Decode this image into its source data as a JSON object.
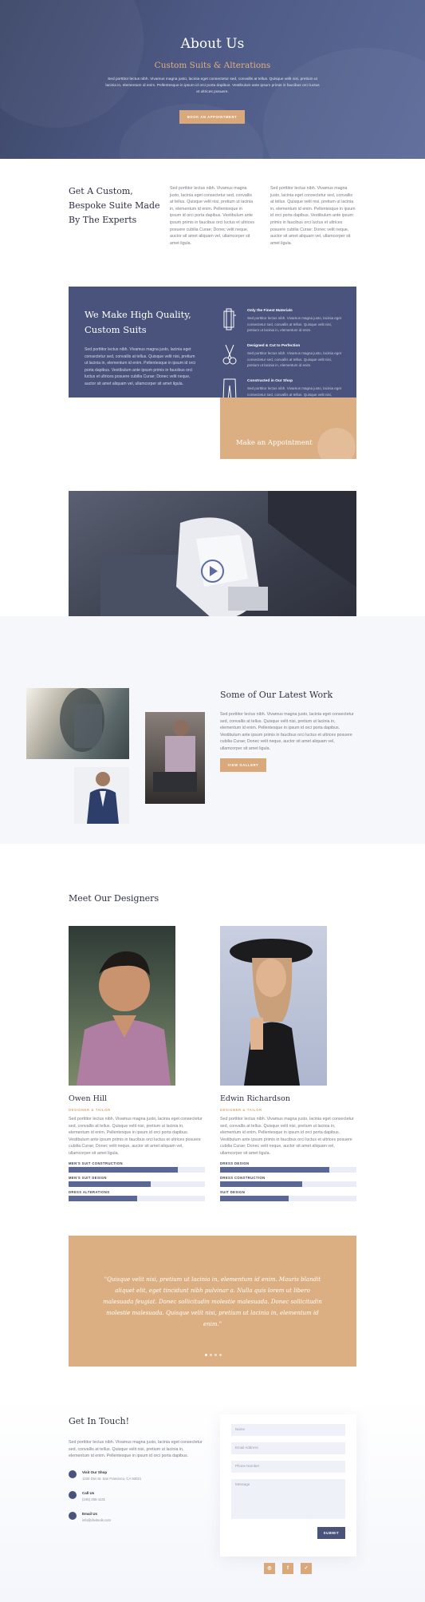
{
  "hero": {
    "title": "About Us",
    "subtitle": "Custom Suits & Alterations",
    "text": "Sed porttitor lectus nibh. Vivamus magna justo, lacinia eget consectetur sed, convallis at tellus. Quisque velit nisi, pretium ut lacinia in, elementum id enim. Pellentesque in ipsum id orci porta dapibus. Vestibulum ante ipsum primis in faucibus orci luctus et ultrices posuere.",
    "button": "BOOK AN APPOINTMENT"
  },
  "intro": {
    "title": "Get A Custom, Bespoke Suite Made By The Experts",
    "col1": "Sed porttitor lectus nibh. Vivamus magna justo, lacinia eget consectetur sed, convallis at tellus. Quisque velit nisi, pretium ut lacinia in, elementum id enim. Pellentesque in ipsum id orci porta dapibus. Vestibulum ante ipsum primis in faucibus orci luctus et ultrices posuere cubilia Curae; Donec velit neque, auctor sit amet aliquam vel, ullamcorper sit amet ligula.",
    "col2": "Sed porttitor lectus nibh. Vivamus magna justo, lacinia eget consectetur sed, convallis at tellus. Quisque velit nisi, pretium ut lacinia in, elementum id enim. Pellentesque in ipsum id orci porta dapibus. Vestibulum ante ipsum primis in faucibus orci luctus et ultrices posuere cubilia Curae; Donec velit neque, auctor sit amet aliquam vel, ullamcorper sit amet ligula."
  },
  "feature": {
    "title": "We Make High Quality, Custom Suits",
    "text": "Sed porttitor lectus nibh. Vivamus magna justo, lacinia eget consectetur sed, convallis at tellus. Quisque velit nisi, pretium ut lacinia in, elementum id enim. Pellentesque in ipsum id orci porta dapibus. Vestibulum ante ipsum primis in faucibus orci luctus et ultrices posuere cubilia Curae; Donec velit neque, auctor sit amet aliquam vel, ullamcorper sit amet ligula.",
    "items": [
      {
        "title": "Only the Finest Materials",
        "text": "Sed porttitor lectus nibh. Vivamus magna justo, lacinia eget consectetur sed, convallis at tellus. Quisque velit nisi, pretium ut lacinia in, elementum id enim."
      },
      {
        "title": "Designed & Cut to Perfection",
        "text": "Sed porttitor lectus nibh. Vivamus magna justo, lacinia eget consectetur sed, convallis at tellus. Quisque velit nisi, pretium ut lacinia in, elementum id enim."
      },
      {
        "title": "Constructed in Our Shop",
        "text": "Sed porttitor lectus nibh. Vivamus magna justo, lacinia eget consectetur sed, convallis at tellus. Quisque velit nisi, pretium ut lacinia in, elementum id enim."
      }
    ],
    "appointment": "Make an Appointment"
  },
  "gallery": {
    "title": "Some of Our Latest Work",
    "text": "Sed porttitor lectus nibh. Vivamus magna justo, lacinia eget consectetur sed, convallis at tellus. Quisque velit nisi, pretium ut lacinia in, elementum id enim. Pellentesque in ipsum id orci porta dapibus. Vestibulum ante ipsum primis in faucibus orci luctus et ultrices posuere cubilia Curae; Donec velit neque, auctor sit amet aliquam vel, ullamcorper sit amet ligula.",
    "button": "VIEW GALLERY"
  },
  "designers": {
    "title": "Meet Our Designers",
    "people": [
      {
        "name": "Owen Hill",
        "role": "DESIGNER & TAILOR",
        "text": "Sed porttitor lectus nibh. Vivamus magna justo, lacinia eget consectetur sed, convallis at tellus. Quisque velit nisi, pretium ut lacinia in, elementum id enim. Pellentesque in ipsum id orci porta dapibus. Vestibulum ante ipsum primis in faucibus orci luctus et ultrices posuere cubilia Curae; Donec velit neque, auctor sit amet aliquam vel, ullamcorper sit amet ligula.",
        "skills": [
          {
            "label": "MEN'S SUIT CONSTRUCTION",
            "level": 0.8
          },
          {
            "label": "MEN'S SUIT DESIGN",
            "level": 0.6
          },
          {
            "label": "DRESS ALTERATIONS",
            "level": 0.5
          }
        ]
      },
      {
        "name": "Edwin Richardson",
        "role": "DESIGNER & TAILOR",
        "text": "Sed porttitor lectus nibh. Vivamus magna justo, lacinia eget consectetur sed, convallis at tellus. Quisque velit nisi, pretium ut lacinia in, elementum id enim. Pellentesque in ipsum id orci porta dapibus. Vestibulum ante ipsum primis in faucibus orci luctus et ultrices posuere cubilia Curae; Donec velit neque, auctor sit amet aliquam vel, ullamcorper sit amet ligula.",
        "skills": [
          {
            "label": "DRESS DESIGN",
            "level": 0.8
          },
          {
            "label": "DRESS CONSTRUCTION",
            "level": 0.6
          },
          {
            "label": "SUIT DESIGN",
            "level": 0.5
          }
        ]
      }
    ]
  },
  "testimonial": {
    "quote": "\"Quisque velit nisi, pretium ut lacinia in, elementum id enim. Mauris blandit aliquet elit, eget tincidunt nibh pulvinar a. Nulla quis lorem ut libero malesuada feugiat. Donec sollicitudin molestie malesuada. Donec sollicitudin molestie malesuada. Quisque velit nisi, pretium ut lacinia in, elementum id enim.\""
  },
  "contact": {
    "title": "Get In Touch!",
    "text": "Sed porttitor lectus nibh. Vivamus magna justo, lacinia eget consectetur sed, convallis at tellus. Quisque velit nisi, pretium ut lacinia in, elementum id enim. Pellentesque in ipsum id orci porta dapibus.",
    "info": [
      {
        "title": "Visit Our Shop",
        "text": "1234 Divi St. San Francisco, CA 93021",
        "icon": "map-pin-icon"
      },
      {
        "title": "Call Us",
        "text": "(245) 255-1131",
        "icon": "phone-icon"
      },
      {
        "title": "Email Us",
        "text": "info@divitools.com",
        "icon": "email-icon"
      }
    ],
    "form": {
      "name": "Name",
      "email": "Email Address",
      "phone": "Phone Number",
      "message": "Message",
      "submit": "SUBMIT"
    }
  },
  "social": [
    {
      "icon": "instagram-icon",
      "glyph": "◎"
    },
    {
      "icon": "facebook-icon",
      "glyph": "f"
    },
    {
      "icon": "twitter-icon",
      "glyph": "✓"
    }
  ],
  "colors": {
    "navy": "#49537c",
    "tan": "#d9a97c",
    "dark_text": "#2e3142"
  }
}
